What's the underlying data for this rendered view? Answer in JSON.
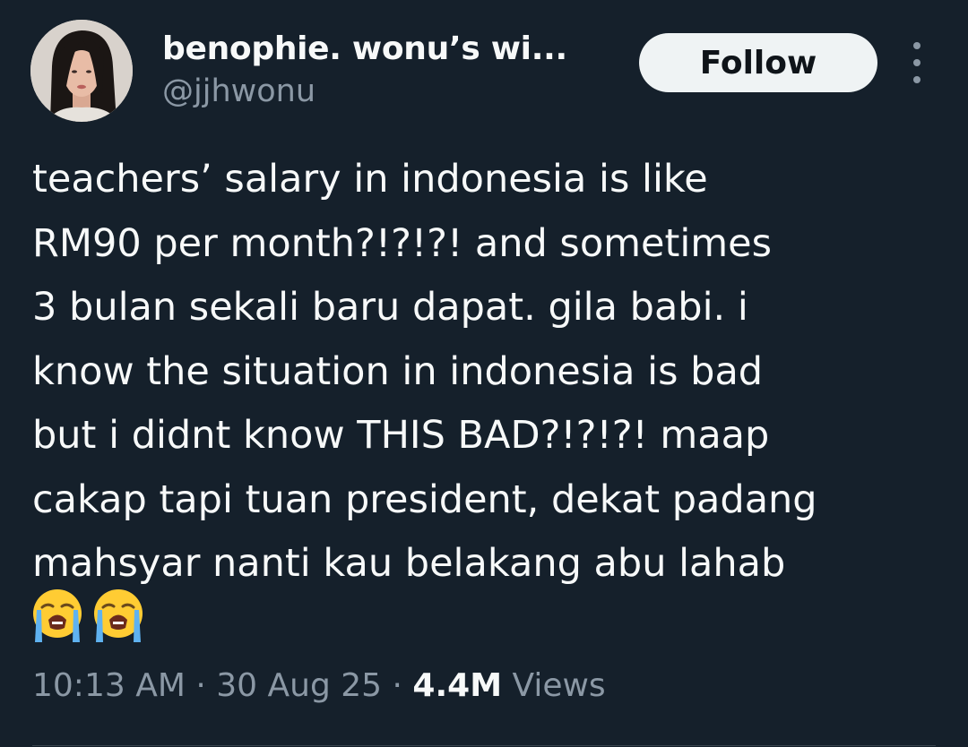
{
  "author": {
    "display_name": "benophie. wonu’s wi...",
    "handle": "@jjhwonu",
    "avatar_icon": "profile-photo-avatar"
  },
  "actions": {
    "follow_label": "Follow",
    "more_icon": "more-vertical-icon"
  },
  "tweet": {
    "lines": [
      "teachers’ salary in indonesia is like",
      "RM90 per month?!?!?! and sometimes",
      "3 bulan sekali baru dapat. gila babi. i",
      "know the situation in indonesia is bad",
      "but i didnt know THIS BAD?!?!?! maap",
      "cakap tapi tuan president, dekat padang",
      "mahsyar nanti kau belakang abu lahab"
    ],
    "emojis": [
      "loudly-crying-face",
      "loudly-crying-face"
    ]
  },
  "meta": {
    "time": "10:13 AM",
    "separator": "·",
    "date": "30 Aug 25",
    "views_count": "4.4M",
    "views_label": "Views"
  },
  "colors": {
    "background": "#15202b",
    "primary_text": "#f7f9f9",
    "secondary_text": "#8b98a5",
    "follow_button_bg": "#eff3f4",
    "follow_button_text": "#0f1419"
  }
}
